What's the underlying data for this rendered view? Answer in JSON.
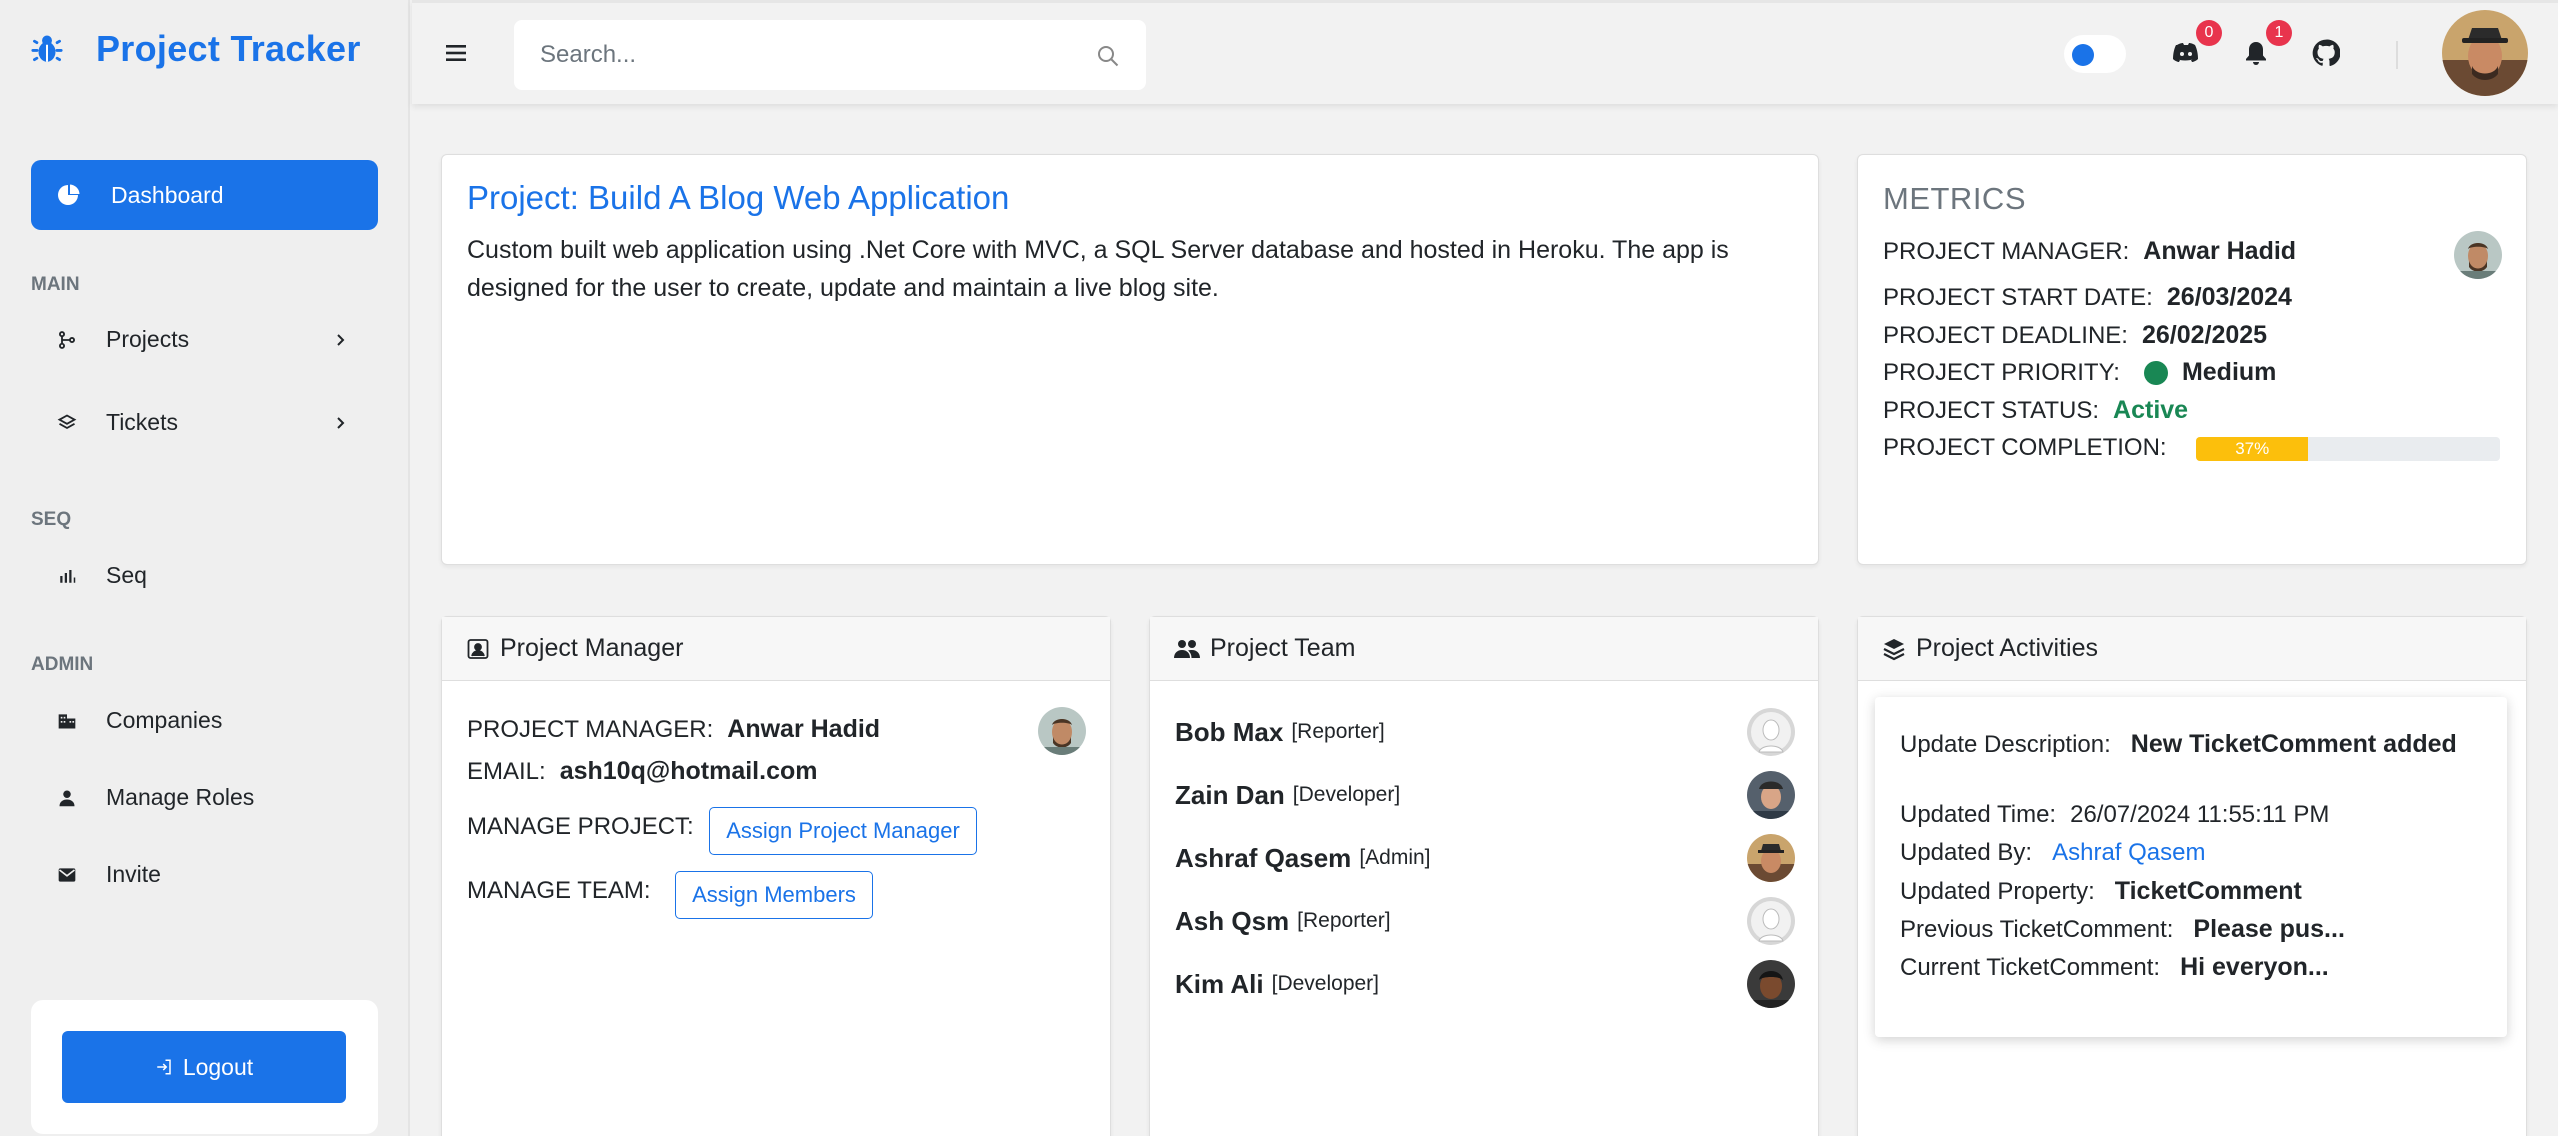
{
  "app": {
    "title": "Project Tracker"
  },
  "sidebar": {
    "dashboard_label": "Dashboard",
    "sections": {
      "main": "MAIN",
      "seq": "SEQ",
      "admin": "ADMIN"
    },
    "items": {
      "projects": "Projects",
      "tickets": "Tickets",
      "seq": "Seq",
      "companies": "Companies",
      "manage_roles": "Manage Roles",
      "invite": "Invite"
    },
    "logout_label": "Logout"
  },
  "header": {
    "search_placeholder": "Search...",
    "messages_count": "0",
    "notifications_count": "1"
  },
  "project": {
    "title": "Project: Build A Blog Web Application",
    "description": "Custom built web application using .Net Core with MVC, a SQL Server database and hosted in Heroku. The app is designed for the user to create, update and maintain a live blog site."
  },
  "metrics": {
    "title": "METRICS",
    "manager_label": "PROJECT MANAGER:",
    "manager": "Anwar Hadid",
    "start_label": "PROJECT START DATE:",
    "start_date": "26/03/2024",
    "deadline_label": "PROJECT DEADLINE:",
    "deadline": "26/02/2025",
    "priority_label": "PROJECT PRIORITY:",
    "priority": "Medium",
    "status_label": "PROJECT STATUS:",
    "status": "Active",
    "completion_label": "PROJECT COMPLETION:",
    "completion_text": "37%",
    "completion": 37,
    "colors": {
      "accent": "#1a73e8",
      "priority": "#198754",
      "progress": "#fcbf0c"
    }
  },
  "manager_card": {
    "title": "Project Manager",
    "manager_label": "PROJECT MANAGER:",
    "manager": "Anwar Hadid",
    "email_label": "EMAIL:",
    "email": "ash10q@hotmail.com",
    "manage_project_label": "MANAGE PROJECT:",
    "assign_pm_button": "Assign Project Manager",
    "manage_team_label": "MANAGE TEAM:",
    "assign_members_button": "Assign Members"
  },
  "team_card": {
    "title": "Project Team",
    "members": [
      {
        "name": "Bob Max",
        "role": "[Reporter]"
      },
      {
        "name": "Zain Dan",
        "role": "[Developer]"
      },
      {
        "name": "Ashraf Qasem",
        "role": "[Admin]"
      },
      {
        "name": "Ash Qsm",
        "role": "[Reporter]"
      },
      {
        "name": "Kim Ali",
        "role": "[Developer]"
      }
    ]
  },
  "activities_card": {
    "title": "Project Activities",
    "update_description_label": "Update Description:",
    "update_description": "New TicketComment added",
    "updated_time_label": "Updated Time:",
    "updated_time": "26/07/2024 11:55:11 PM",
    "updated_by_label": "Updated By:",
    "updated_by": "Ashraf Qasem",
    "updated_property_label": "Updated Property:",
    "updated_property": "TicketComment",
    "previous_label": "Previous TicketComment:",
    "previous_value": "Please pus...",
    "current_label": "Current TicketComment:",
    "current_value": "Hi everyon..."
  }
}
